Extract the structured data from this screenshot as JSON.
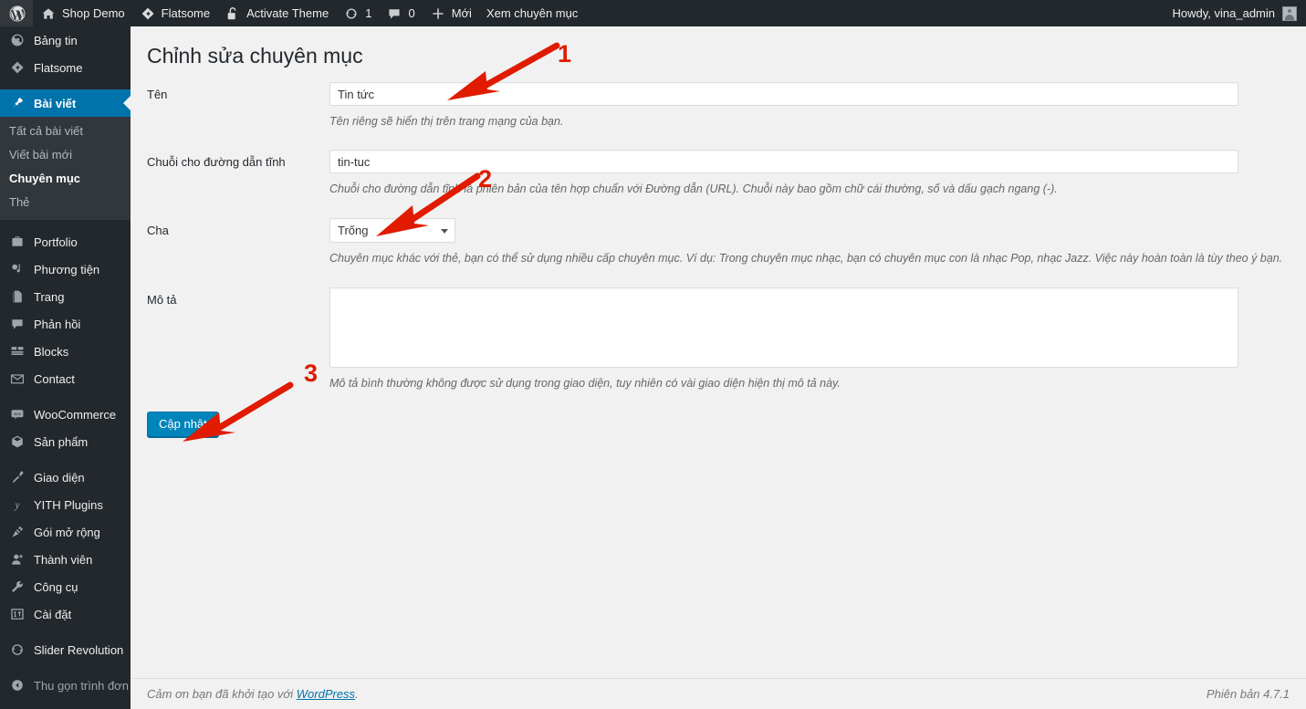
{
  "adminbar": {
    "logo_icon": "wordpress-logo-icon",
    "items": [
      {
        "icon": "home-icon",
        "label": "Shop Demo",
        "name": "adminbar-site-name"
      },
      {
        "icon": "flatsome-icon",
        "label": "Flatsome",
        "name": "adminbar-flatsome"
      },
      {
        "icon": "lock-open-icon",
        "label": "Activate Theme",
        "name": "adminbar-activate-theme"
      },
      {
        "icon": "updates-icon",
        "label": "1",
        "name": "adminbar-updates"
      },
      {
        "icon": "comment-icon",
        "label": "0",
        "name": "adminbar-comments"
      },
      {
        "icon": "plus-icon",
        "label": "Mới",
        "name": "adminbar-new-content"
      },
      {
        "icon": "",
        "label": "Xem chuyên mục",
        "name": "adminbar-view-category"
      }
    ],
    "howdy": "Howdy, vina_admin"
  },
  "sidebar": {
    "items": [
      {
        "icon": "dashboard-icon",
        "label": "Bảng tin",
        "name": "sidebar-item-dashboard",
        "state": "normal",
        "sep_after": false
      },
      {
        "icon": "flatsome-icon",
        "label": "Flatsome",
        "name": "sidebar-item-flatsome",
        "state": "normal",
        "sep_after": true
      },
      {
        "icon": "pin-icon",
        "label": "Bài viết",
        "name": "sidebar-item-posts",
        "state": "current",
        "sep_after": false
      },
      {
        "icon": "portfolio-icon",
        "label": "Portfolio",
        "name": "sidebar-item-portfolio",
        "state": "normal",
        "sep_after": false
      },
      {
        "icon": "media-icon",
        "label": "Phương tiện",
        "name": "sidebar-item-media",
        "state": "normal",
        "sep_after": false
      },
      {
        "icon": "page-icon",
        "label": "Trang",
        "name": "sidebar-item-pages",
        "state": "normal",
        "sep_after": false
      },
      {
        "icon": "comment-icon",
        "label": "Phản hồi",
        "name": "sidebar-item-comments",
        "state": "normal",
        "sep_after": false
      },
      {
        "icon": "blocks-icon",
        "label": "Blocks",
        "name": "sidebar-item-blocks",
        "state": "normal",
        "sep_after": false
      },
      {
        "icon": "mail-icon",
        "label": "Contact",
        "name": "sidebar-item-contact",
        "state": "normal",
        "sep_after": true
      },
      {
        "icon": "woocommerce-icon",
        "label": "WooCommerce",
        "name": "sidebar-item-woocommerce",
        "state": "normal",
        "sep_after": false
      },
      {
        "icon": "product-icon",
        "label": "Sản phẩm",
        "name": "sidebar-item-products",
        "state": "normal",
        "sep_after": true
      },
      {
        "icon": "appearance-icon",
        "label": "Giao diện",
        "name": "sidebar-item-appearance",
        "state": "normal",
        "sep_after": false
      },
      {
        "icon": "yith-icon",
        "label": "YITH Plugins",
        "name": "sidebar-item-yith",
        "state": "normal",
        "sep_after": false
      },
      {
        "icon": "plugins-icon",
        "label": "Gói mở rộng",
        "name": "sidebar-item-plugins",
        "state": "normal",
        "sep_after": false
      },
      {
        "icon": "users-icon",
        "label": "Thành viên",
        "name": "sidebar-item-users",
        "state": "normal",
        "sep_after": false
      },
      {
        "icon": "tools-icon",
        "label": "Công cụ",
        "name": "sidebar-item-tools",
        "state": "normal",
        "sep_after": false
      },
      {
        "icon": "settings-icon",
        "label": "Cài đặt",
        "name": "sidebar-item-settings",
        "state": "normal",
        "sep_after": true
      },
      {
        "icon": "slider-icon",
        "label": "Slider Revolution",
        "name": "sidebar-item-slider-revolution",
        "state": "normal",
        "sep_after": true
      },
      {
        "icon": "collapse-icon",
        "label": "Thu gọn trình đơn",
        "name": "sidebar-item-collapse-menu",
        "state": "dim",
        "sep_after": false
      }
    ],
    "submenu": {
      "parent": "sidebar-item-posts",
      "items": [
        {
          "label": "Tất cả bài viết",
          "name": "submenu-all-posts",
          "current": false
        },
        {
          "label": "Viết bài mới",
          "name": "submenu-add-new",
          "current": false
        },
        {
          "label": "Chuyên mục",
          "name": "submenu-categories",
          "current": true
        },
        {
          "label": "Thẻ",
          "name": "submenu-tags",
          "current": false
        }
      ]
    }
  },
  "page": {
    "title": "Chỉnh sửa chuyên mục"
  },
  "form": {
    "name": {
      "label": "Tên",
      "value": "Tin tức",
      "placeholder": "",
      "description": "Tên riêng sẽ hiển thị trên trang mạng của bạn."
    },
    "slug": {
      "label": "Chuỗi cho đường dẫn tĩnh",
      "value": "tin-tuc",
      "placeholder": "",
      "description": "Chuỗi cho đường dẫn tĩnh là phiên bản của tên hợp chuẩn với Đường dẫn (URL). Chuỗi này bao gồm chữ cái thường, số và dấu gạch ngang (-)."
    },
    "parent": {
      "label": "Cha",
      "value": "Trống",
      "options": [
        "Trống"
      ],
      "description": "Chuyên mục khác với thẻ, bạn có thể sử dụng nhiều cấp chuyên mục. Ví dụ: Trong chuyên mục nhạc, bạn có chuyên mục con là nhạc Pop, nhạc Jazz. Việc này hoàn toàn là tùy theo ý bạn."
    },
    "description": {
      "label": "Mô tả",
      "value": "",
      "placeholder": "",
      "description": "Mô tả bình thường không được sử dụng trong giao diện, tuy nhiên có vài giao diện hiện thị mô tả này."
    },
    "submit_label": "Cập nhật"
  },
  "footer": {
    "thanks_prefix": "Cảm ơn bạn đã khởi tạo với ",
    "link_label": "WordPress",
    "thanks_suffix": ".",
    "version": "Phiên bản 4.7.1"
  },
  "annotations": {
    "color": "#e01b00",
    "markers": [
      {
        "number": "1",
        "name": "annotation-marker-1"
      },
      {
        "number": "2",
        "name": "annotation-marker-2"
      },
      {
        "number": "3",
        "name": "annotation-marker-3"
      }
    ]
  },
  "colors": {
    "admin_dark": "#23282d",
    "admin_submenu": "#32373c",
    "accent_blue": "#0073aa",
    "button_blue": "#0085ba",
    "page_bg": "#f1f1f1",
    "annotation_red": "#e01b00"
  }
}
